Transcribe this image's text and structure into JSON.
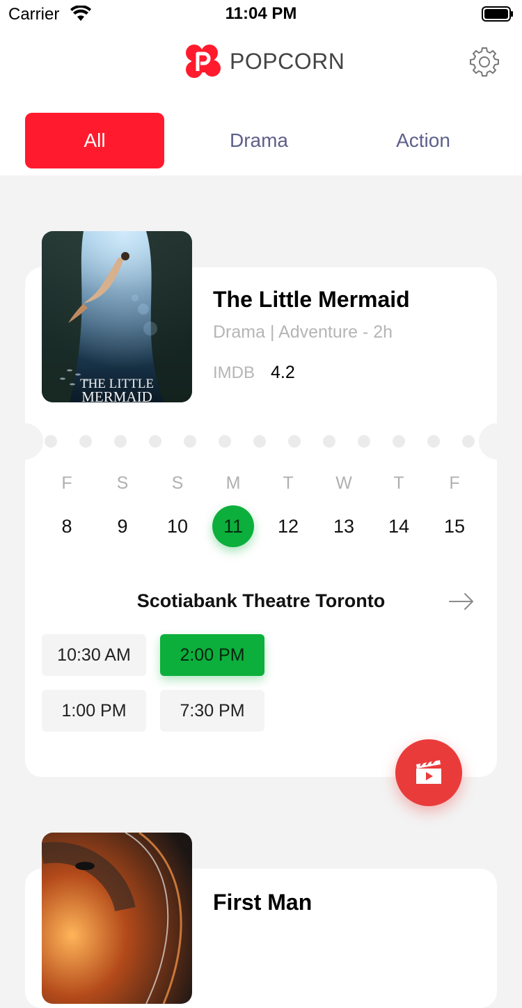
{
  "status_bar": {
    "carrier": "Carrier",
    "time": "11:04 PM"
  },
  "header": {
    "brand": "POPCORN"
  },
  "tabs": [
    {
      "label": "All",
      "active": true
    },
    {
      "label": "Drama",
      "active": false
    },
    {
      "label": "Action",
      "active": false
    }
  ],
  "movies": [
    {
      "title": "The Little Mermaid",
      "genre": "Drama | Adventure - 2h",
      "imdb_label": "IMDB",
      "imdb_score": "4.2",
      "poster_text_line1": "THE LITTLE",
      "poster_text_line2": "MERMAID",
      "days": [
        {
          "letter": "F",
          "num": "8"
        },
        {
          "letter": "S",
          "num": "9"
        },
        {
          "letter": "S",
          "num": "10"
        },
        {
          "letter": "M",
          "num": "11",
          "selected": true
        },
        {
          "letter": "T",
          "num": "12"
        },
        {
          "letter": "W",
          "num": "13"
        },
        {
          "letter": "T",
          "num": "14"
        },
        {
          "letter": "F",
          "num": "15"
        }
      ],
      "theatre": "Scotiabank Theatre Toronto",
      "times": [
        {
          "label": "10:30 AM"
        },
        {
          "label": "2:00 PM",
          "selected": true
        },
        {
          "label": "1:00 PM"
        },
        {
          "label": "7:30 PM"
        }
      ]
    },
    {
      "title": "First Man"
    }
  ],
  "colors": {
    "accent_red": "#ff1b2d",
    "accent_green": "#0caf3c",
    "tab_text": "#5d6089",
    "fab": "#ea3b3b"
  }
}
